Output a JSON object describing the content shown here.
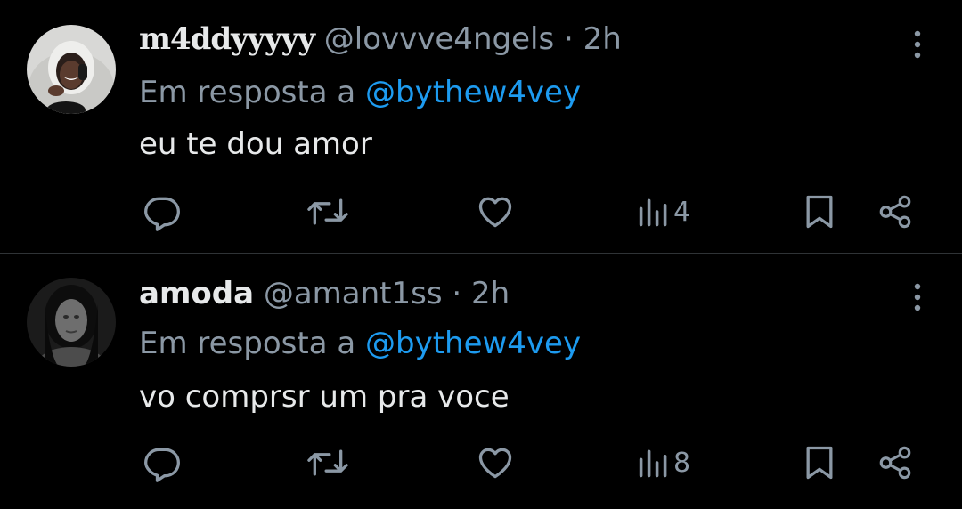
{
  "replies": [
    {
      "display_name": "m4ddyyyyy",
      "handle": "@lovvve4ngels",
      "separator": "·",
      "time": "2h",
      "reply_prefix": "Em resposta a",
      "reply_to": "@bythew4vey",
      "text": "eu te dou amor",
      "views": "4"
    },
    {
      "display_name": "amoda",
      "handle": "@amant1ss",
      "separator": "·",
      "time": "2h",
      "reply_prefix": "Em resposta a",
      "reply_to": "@bythew4vey",
      "text": "vo comprsr um pra voce",
      "views": "8"
    }
  ],
  "colors": {
    "background": "#000000",
    "primary_text": "#e7e9ea",
    "secondary_text": "#8b98a5",
    "link": "#1d9bf0",
    "divider": "#2f3336"
  },
  "icons": [
    "reply-icon",
    "retweet-icon",
    "like-icon",
    "views-icon",
    "bookmark-icon",
    "share-icon",
    "more-icon"
  ]
}
